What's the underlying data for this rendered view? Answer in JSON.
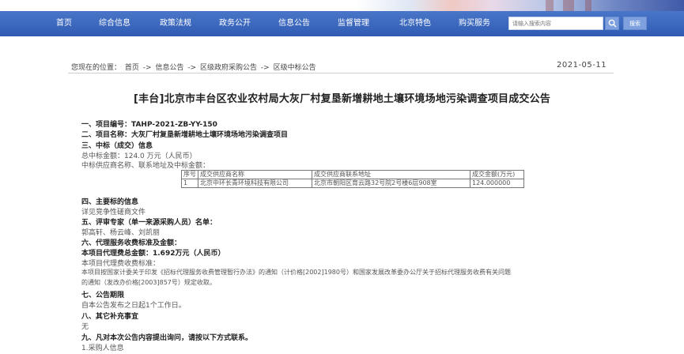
{
  "nav": {
    "items": [
      "首页",
      "综合信息",
      "政策法规",
      "政务公开",
      "信息公告",
      "监督管理",
      "北京特色",
      "购买服务"
    ],
    "search_placeholder": "请输入搜索内容",
    "search_button": "搜索"
  },
  "breadcrumb": {
    "prefix": "您现在的位置：",
    "items": [
      "首页",
      "信息公告",
      "区级政府采购公告",
      "区级中标公告"
    ],
    "separator": "->"
  },
  "date": "2021-05-11",
  "title": "[丰台]北京市丰台区农业农村局大灰厂村复垦新增耕地土壤环境场地污染调查项目成交公告",
  "sections": {
    "s1": "一、项目编号：TAHP-2021-ZB-YY-150",
    "s2": "二、项目名称：大灰厂村复垦新增耕地土壤环境场地污染调查项目",
    "s3": "三、中标（成交）信息",
    "s3_amount": "总中标金额：124.0 万元（人民币）",
    "s3_desc": "中标供应商名称、联系地址及中标金额：",
    "table_headers": [
      "序号",
      "成交供应商名称",
      "成交供应商联系地址",
      "成交金额(万元)"
    ],
    "table_rows": [
      [
        "1",
        "北京中环长青环境科技有限公司",
        "北京市朝阳区育云路32号院2号楼6层908室",
        "124.000000"
      ]
    ],
    "s4": "四、主要标的信息",
    "s4_desc": "详见竞争性磋商文件",
    "s5": "五、评审专家（单一来源采购人员）名单：",
    "s5_desc": "郭高轩、杨云峰、刘凯丽",
    "s6": "六、代理服务收费标准及金额：",
    "s6_total": "本项目代理费总金额：1.692万元（人民币）",
    "s6_std": "本项目代理费收费标准：",
    "s6_text1": "本项目按国家计委关于印发《招标代理服务收费管理暂行办法》的通知（计价格[2002]1980号）和国家发展改革委办公厅关于招标代理服务收费有关问题",
    "s6_text2": "的通知（发改办价格[2003]857号）规定收取。",
    "s7": "七、公告期限",
    "s7_desc": "自本公告发布之日起1个工作日。",
    "s8": "八、其它补充事宜",
    "s8_desc": "无",
    "s9": "九、凡对本次公告内容提出询问，请按以下方式联系。",
    "s9_desc": "1.采购人信息"
  }
}
